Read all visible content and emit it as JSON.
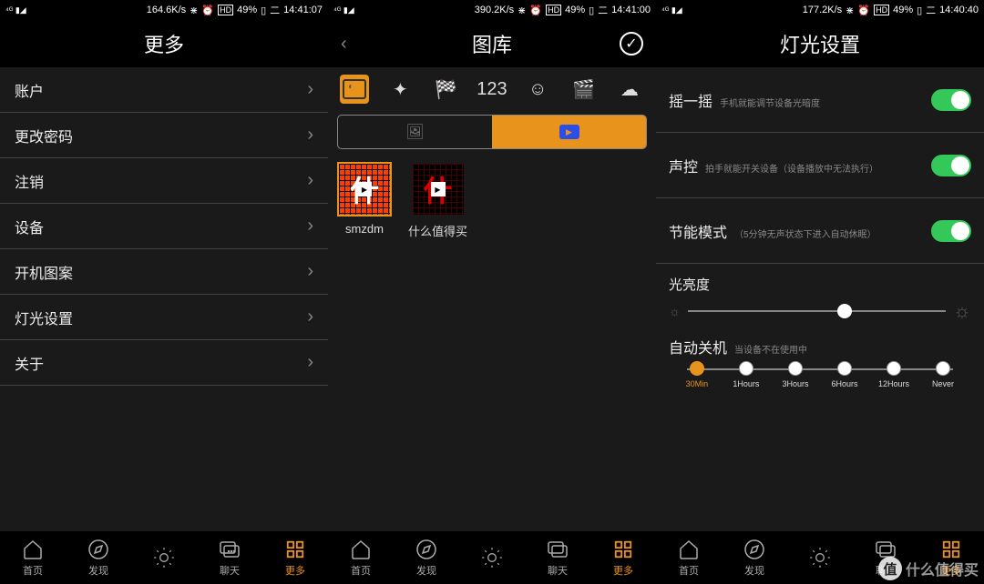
{
  "screens": {
    "s1": {
      "status": {
        "net": "164.6K/s",
        "battery": "49%",
        "time": "14:41:07",
        "sig": "⁴ᴳ ₊ᵢₗ"
      },
      "title": "更多",
      "items": [
        {
          "label": "账户"
        },
        {
          "label": "更改密码"
        },
        {
          "label": "注销"
        },
        {
          "label": "设备"
        },
        {
          "label": "开机图案"
        },
        {
          "label": "灯光设置"
        },
        {
          "label": "关于"
        }
      ]
    },
    "s2": {
      "status": {
        "net": "390.2K/s",
        "battery": "49%",
        "time": "14:41:00"
      },
      "title": "图库",
      "toolbar_num": "123",
      "gallery": [
        {
          "label": "smzdm"
        },
        {
          "label": "什么值得买"
        }
      ]
    },
    "s3": {
      "status": {
        "net": "177.2K/s",
        "battery": "49%",
        "time": "14:40:40"
      },
      "title": "灯光设置",
      "rows": [
        {
          "title": "摇一摇",
          "desc": "手机就能调节设备光暗度"
        },
        {
          "title": "声控",
          "desc": "拍手就能开关设备（设备播放中无法执行）"
        },
        {
          "title": "节能模式",
          "desc": "（5分钟无声状态下进入自动休眠）"
        }
      ],
      "brightness": {
        "title": "光亮度"
      },
      "autooff": {
        "title": "自动关机",
        "desc": "当设备不在使用中",
        "steps": [
          "30Min",
          "1Hours",
          "3Hours",
          "6Hours",
          "12Hours",
          "Never"
        ]
      }
    }
  },
  "nav": [
    {
      "label": "首页",
      "icon": "home"
    },
    {
      "label": "发现",
      "icon": "compass"
    },
    {
      "label": "",
      "icon": "sun"
    },
    {
      "label": "聊天",
      "icon": "chat"
    },
    {
      "label": "更多",
      "icon": "grid",
      "active": true
    }
  ],
  "watermark": {
    "badge": "值",
    "text": "什么值得买"
  }
}
